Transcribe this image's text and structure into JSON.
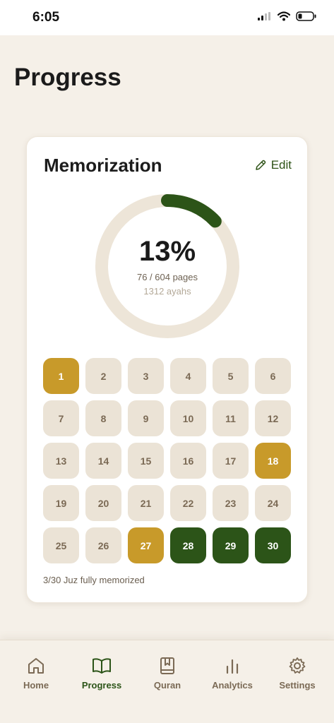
{
  "status_bar": {
    "time": "6:05"
  },
  "page": {
    "title": "Progress"
  },
  "memorization": {
    "title": "Memorization",
    "edit_label": "Edit",
    "progress_fraction": 0.13,
    "percent_label": "13%",
    "pages_label": "76 / 604 pages",
    "ayahs_label": "1312 ayahs",
    "summary": "3/30 Juz fully memorized",
    "juz": [
      {
        "label": "1",
        "state": "partial"
      },
      {
        "label": "2",
        "state": "none"
      },
      {
        "label": "3",
        "state": "none"
      },
      {
        "label": "4",
        "state": "none"
      },
      {
        "label": "5",
        "state": "none"
      },
      {
        "label": "6",
        "state": "none"
      },
      {
        "label": "7",
        "state": "none"
      },
      {
        "label": "8",
        "state": "none"
      },
      {
        "label": "9",
        "state": "none"
      },
      {
        "label": "10",
        "state": "none"
      },
      {
        "label": "11",
        "state": "none"
      },
      {
        "label": "12",
        "state": "none"
      },
      {
        "label": "13",
        "state": "none"
      },
      {
        "label": "14",
        "state": "none"
      },
      {
        "label": "15",
        "state": "none"
      },
      {
        "label": "16",
        "state": "none"
      },
      {
        "label": "17",
        "state": "none"
      },
      {
        "label": "18",
        "state": "partial"
      },
      {
        "label": "19",
        "state": "none"
      },
      {
        "label": "20",
        "state": "none"
      },
      {
        "label": "21",
        "state": "none"
      },
      {
        "label": "22",
        "state": "none"
      },
      {
        "label": "23",
        "state": "none"
      },
      {
        "label": "24",
        "state": "none"
      },
      {
        "label": "25",
        "state": "none"
      },
      {
        "label": "26",
        "state": "none"
      },
      {
        "label": "27",
        "state": "partial"
      },
      {
        "label": "28",
        "state": "full"
      },
      {
        "label": "29",
        "state": "full"
      },
      {
        "label": "30",
        "state": "full"
      }
    ]
  },
  "tabs": [
    {
      "label": "Home",
      "icon": "home-icon",
      "active": false
    },
    {
      "label": "Progress",
      "icon": "open-book-icon",
      "active": true
    },
    {
      "label": "Quran",
      "icon": "bookmark-book-icon",
      "active": false
    },
    {
      "label": "Analytics",
      "icon": "bar-chart-icon",
      "active": false
    },
    {
      "label": "Settings",
      "icon": "gear-icon",
      "active": false
    }
  ],
  "colors": {
    "accent_green": "#2c5418",
    "accent_gold": "#c89a2a",
    "background": "#f5f0e8",
    "ring_track": "#ede5d8"
  }
}
